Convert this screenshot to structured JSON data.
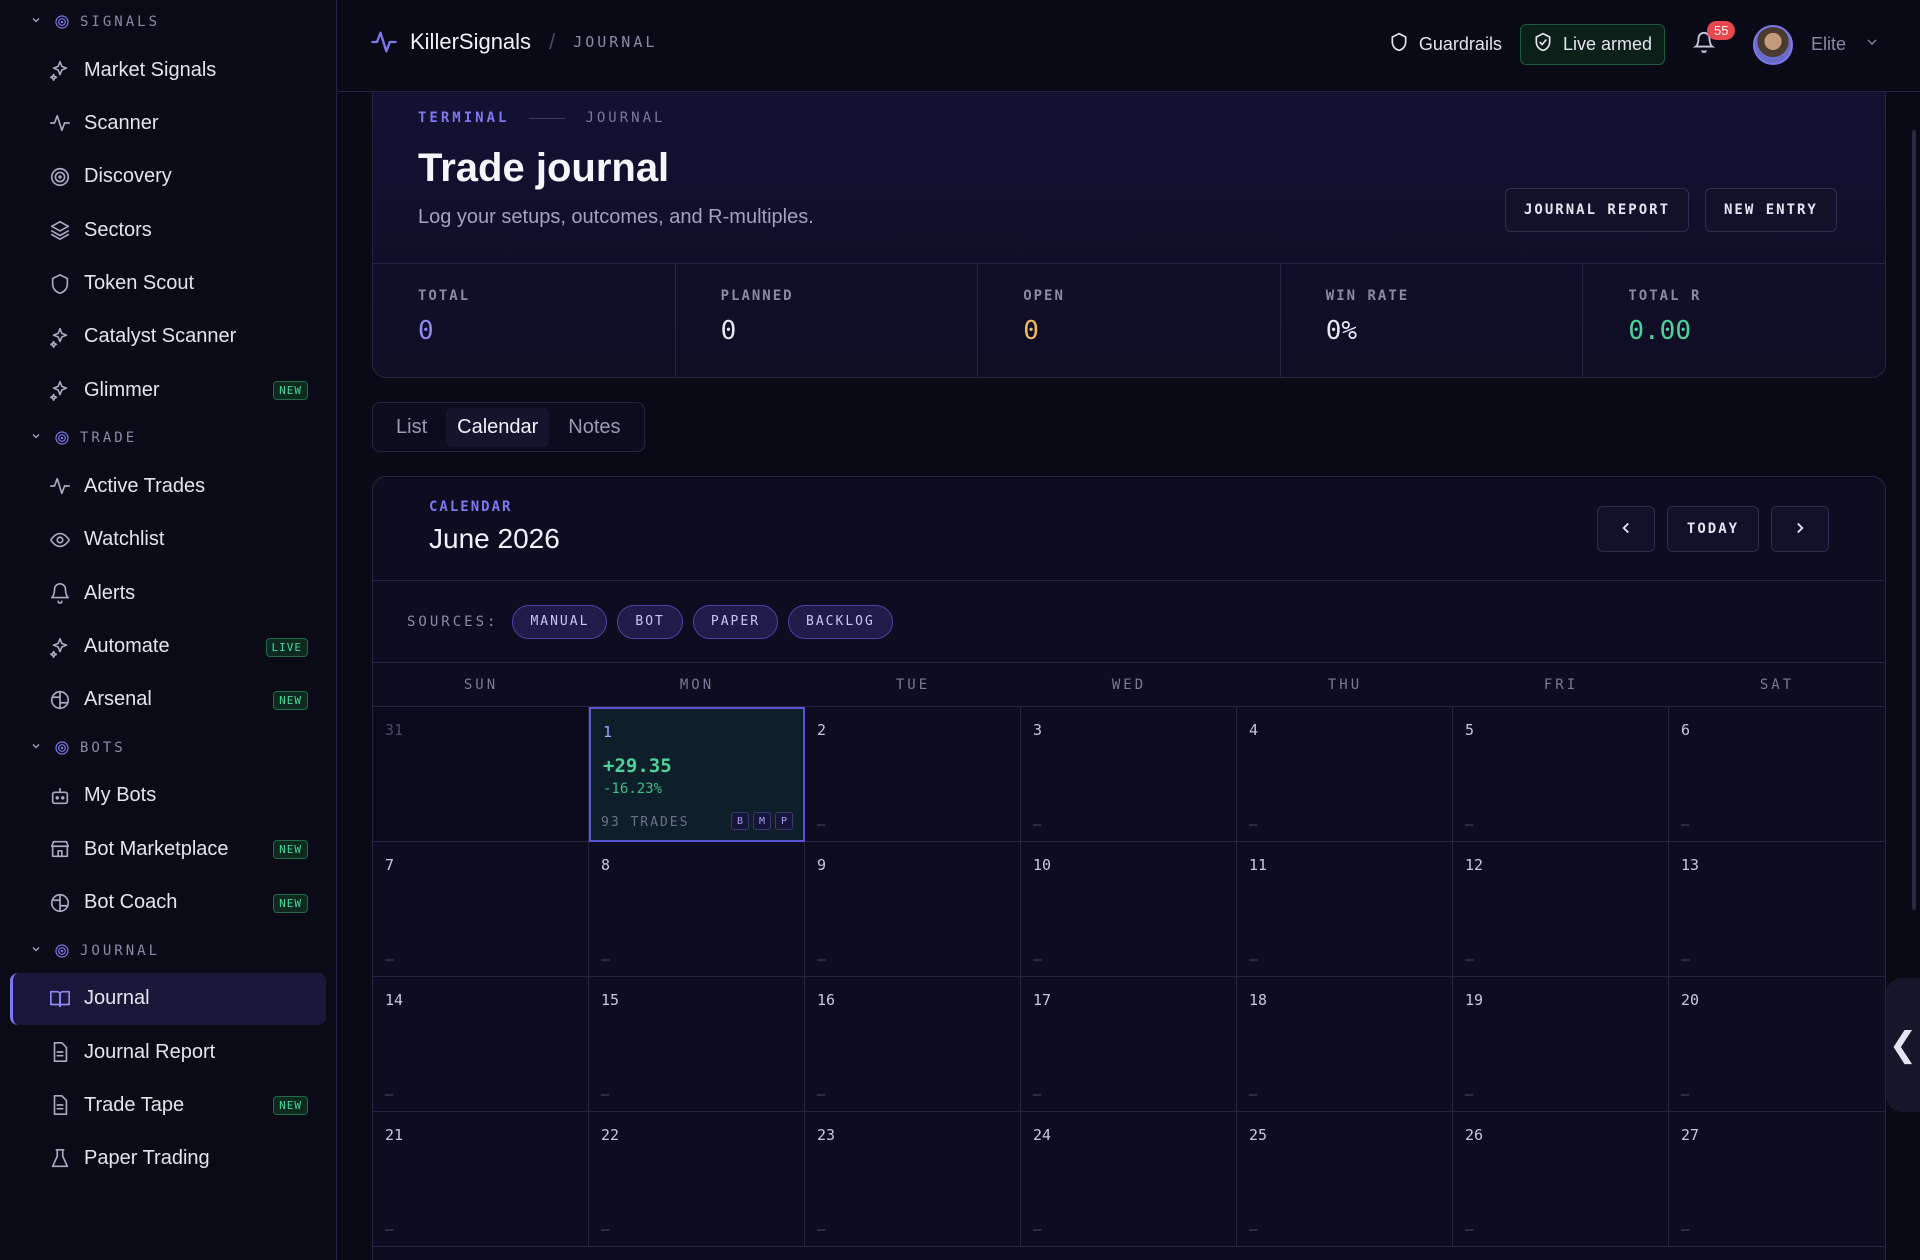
{
  "sidebar": {
    "sections": [
      {
        "title": "SIGNALS",
        "items": [
          {
            "label": "Market Signals",
            "icon": "sparkles-icon"
          },
          {
            "label": "Scanner",
            "icon": "pulse-icon"
          },
          {
            "label": "Discovery",
            "icon": "radar-icon"
          },
          {
            "label": "Sectors",
            "icon": "layers-icon"
          },
          {
            "label": "Token Scout",
            "icon": "shield-icon"
          },
          {
            "label": "Catalyst Scanner",
            "icon": "sparkles-icon"
          },
          {
            "label": "Glimmer",
            "icon": "sparkles-icon",
            "badge": "NEW"
          }
        ]
      },
      {
        "title": "TRADE",
        "items": [
          {
            "label": "Active Trades",
            "icon": "pulse-icon"
          },
          {
            "label": "Watchlist",
            "icon": "eye-icon"
          },
          {
            "label": "Alerts",
            "icon": "bell-icon"
          },
          {
            "label": "Automate",
            "icon": "sparkles-icon",
            "badge": "LIVE"
          },
          {
            "label": "Arsenal",
            "icon": "brain-icon",
            "badge": "NEW"
          }
        ]
      },
      {
        "title": "BOTS",
        "items": [
          {
            "label": "My Bots",
            "icon": "bot-icon"
          },
          {
            "label": "Bot Marketplace",
            "icon": "store-icon",
            "badge": "NEW"
          },
          {
            "label": "Bot Coach",
            "icon": "brain-icon",
            "badge": "NEW"
          }
        ]
      },
      {
        "title": "JOURNAL",
        "items": [
          {
            "label": "Journal",
            "icon": "book-icon",
            "active": true
          },
          {
            "label": "Journal Report",
            "icon": "document-icon"
          },
          {
            "label": "Trade Tape",
            "icon": "document-icon",
            "badge": "NEW"
          },
          {
            "label": "Paper Trading",
            "icon": "flask-icon"
          }
        ]
      }
    ]
  },
  "topbar": {
    "brand": "KillerSignals",
    "crumb": "JOURNAL",
    "guardrails": "Guardrails",
    "live_armed": "Live armed",
    "notifications": "55",
    "tier": "Elite"
  },
  "hero": {
    "crumb1": "TERMINAL",
    "crumb2": "JOURNAL",
    "title": "Trade journal",
    "subtitle": "Log your setups, outcomes, and R-multiples.",
    "report_btn": "JOURNAL REPORT",
    "new_btn": "NEW ENTRY",
    "stats": [
      {
        "label": "TOTAL",
        "value": "0",
        "color": "#8f8af5"
      },
      {
        "label": "PLANNED",
        "value": "0",
        "color": "#e6e6f0"
      },
      {
        "label": "OPEN",
        "value": "0",
        "color": "#f0b95a"
      },
      {
        "label": "WIN RATE",
        "value": "0%",
        "color": "#e6e6f0"
      },
      {
        "label": "TOTAL R",
        "value": "0.00",
        "color": "#4cd39a"
      }
    ]
  },
  "tabs": [
    "List",
    "Calendar",
    "Notes"
  ],
  "active_tab": "Calendar",
  "calendar": {
    "label": "CALENDAR",
    "month": "June 2026",
    "today_btn": "TODAY",
    "sources_label": "SOURCES:",
    "sources": [
      "MANUAL",
      "BOT",
      "PAPER",
      "BACKLOG"
    ],
    "weekdays": [
      "SUN",
      "MON",
      "TUE",
      "WED",
      "THU",
      "FRI",
      "SAT"
    ],
    "days": [
      "31",
      "1",
      "2",
      "3",
      "4",
      "5",
      "6",
      "7",
      "8",
      "9",
      "10",
      "11",
      "12",
      "13",
      "14",
      "15",
      "16",
      "17",
      "18",
      "19",
      "20",
      "21",
      "22",
      "23",
      "24",
      "25",
      "26",
      "27"
    ],
    "empty_marker": "–",
    "highlight": {
      "day": "1",
      "pnl": "+29.35",
      "pct": "-16.23%",
      "trades": "93 TRADES",
      "tags": [
        "B",
        "M",
        "P"
      ]
    }
  }
}
